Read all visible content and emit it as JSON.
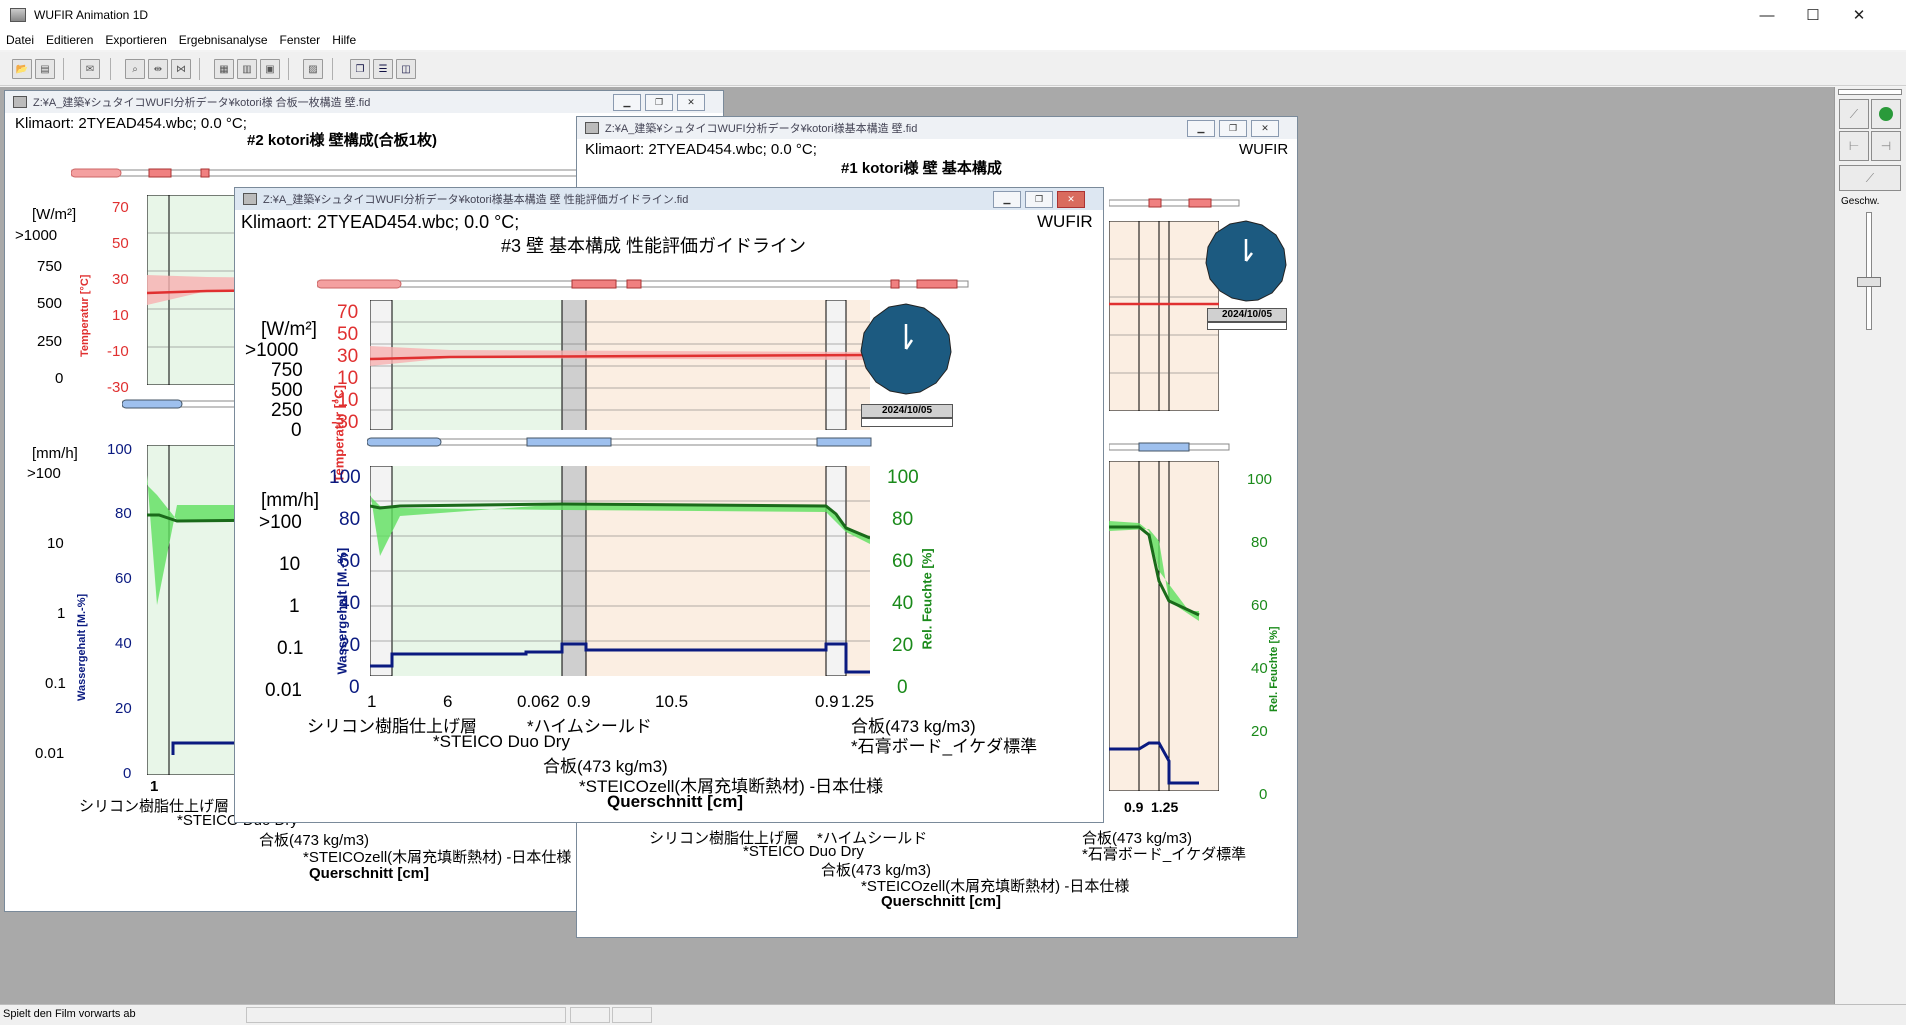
{
  "app": {
    "title": "WUFIR Animation 1D"
  },
  "menu": [
    "Datei",
    "Editieren",
    "Exportieren",
    "Ergebnisanalyse",
    "Fenster",
    "Hilfe"
  ],
  "status": {
    "text": "Spielt den Film vorwarts ab"
  },
  "right_panel": {
    "speed_label": "Geschw."
  },
  "windows": {
    "w2": {
      "path": "Z:¥A_建築¥シュタイコWUFI分析データ¥kotori様 合板一枚構造 壁.fid",
      "klimaort": "Klimaort: 2TYEAD454.wbc; 0.0 °C;",
      "title": "#2  kotori様 壁構成(合板1枚)",
      "flux_unit": "[W/m²]",
      "rain_unit": "[mm/h]",
      "temp_label": "Temperatur [°C]",
      "water_label": "Wassergehalt [M.-%]",
      "flux_ticks": [
        ">1000",
        "750",
        "500",
        "250",
        "0"
      ],
      "temp_ticks": [
        "70",
        "50",
        "30",
        "10",
        "-10",
        "-30"
      ],
      "rain_ticks": [
        ">100",
        "10",
        "1",
        "0.1",
        "0.01"
      ],
      "wc_ticks": [
        "100",
        "80",
        "60",
        "40",
        "20",
        "0"
      ],
      "x_ticks": [
        "1"
      ],
      "layers": [
        "シリコン樹脂仕上げ層",
        "*STEICO Duo Dry",
        "合板(473 kg/m3)",
        "*STEICOzell(木屑充填断熱材) -日本仕様"
      ],
      "xlabel": "Querschnitt [cm]"
    },
    "w1": {
      "path": "Z:¥A_建築¥シュタイコWUFI分析データ¥kotori様基本構造 壁.fid",
      "klimaort": "Klimaort: 2TYEAD454.wbc; 0.0 °C;",
      "wufir": "WUFIR",
      "title": "#1 kotori様 壁 基本構成",
      "date": "2024/10/05",
      "rh_ticks": [
        "100",
        "80",
        "60",
        "40",
        "20",
        "0"
      ],
      "rh_label": "Rel. Feuchte [%]",
      "x_ticks": [
        "0.9",
        "1.25"
      ],
      "layers_left": [
        "シリコン樹脂仕上げ層",
        "*STEICO Duo Dry",
        "合板(473 kg/m3)",
        "*STEICOzell(木屑充填断熱材) -日本仕様"
      ],
      "layers_right": [
        "*ハイムシールド",
        "合板(473 kg/m3)",
        "*石膏ボード_イケダ標準"
      ],
      "xlabel": "Querschnitt [cm]"
    },
    "w3": {
      "path": "Z:¥A_建築¥シュタイコWUFI分析データ¥kotori様基本構造 壁 性能評価ガイドライン.fid",
      "klimaort": "Klimaort: 2TYEAD454.wbc; 0.0 °C;",
      "wufir": "WUFIR",
      "title": "#3 壁 基本構成 性能評価ガイドライン",
      "date": "2024/10/05",
      "flux_unit": "[W/m²]",
      "rain_unit": "[mm/h]",
      "temp_label": "Temperatur [°C]",
      "water_label": "Wassergehalt [M.-%]",
      "rh_label": "Rel. Feuchte [%]",
      "flux_ticks": [
        ">1000",
        "750",
        "500",
        "250",
        "0"
      ],
      "temp_ticks": [
        "70",
        "50",
        "30",
        "10",
        "-10",
        "-30"
      ],
      "rain_ticks": [
        ">100",
        "10",
        "1",
        "0.1",
        "0.01"
      ],
      "wc_ticks": [
        "100",
        "80",
        "60",
        "40",
        "20",
        "0"
      ],
      "rh_ticks": [
        "100",
        "80",
        "60",
        "40",
        "20",
        "0"
      ],
      "x_ticks": [
        "1",
        "6",
        "0.062",
        "0.9",
        "10.5",
        "0.9",
        "1.25"
      ],
      "layers": [
        "シリコン樹脂仕上げ層",
        "*ハイムシールド",
        "*STEICO Duo Dry",
        "合板(473 kg/m3)",
        "*石膏ボード_イケダ標準",
        "合板(473 kg/m3)",
        "*STEICOzell(木屑充填断熱材) -日本仕様"
      ],
      "xlabel": "Querschnitt [cm]"
    }
  },
  "colors": {
    "temp": "#e03030",
    "rh": "#1a8a1a",
    "water": "#0a1a80",
    "clock": "#1c5a80",
    "mdi_bg": "#a9a9a9"
  }
}
